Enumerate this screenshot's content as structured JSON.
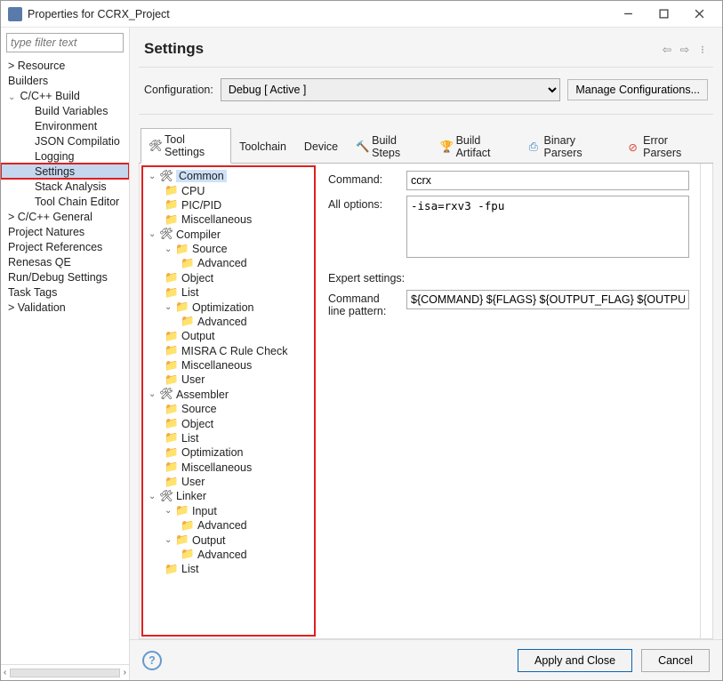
{
  "window": {
    "title": "Properties for CCRX_Project"
  },
  "filter": {
    "placeholder": "type filter text"
  },
  "nav": {
    "resource": ">  Resource",
    "builders": "     Builders",
    "build": "  C/C++ Build",
    "build_vars": "Build Variables",
    "env": "Environment",
    "json": "JSON Compilatio",
    "logging": "Logging",
    "settings": "Settings",
    "stack": "Stack Analysis",
    "tce": "Tool Chain Editor",
    "general": ">  C/C++ General",
    "natures": "     Project Natures",
    "refs": "     Project References",
    "renesas": "     Renesas QE",
    "rundebug": "     Run/Debug Settings",
    "tasktags": "     Task Tags",
    "validation": ">  Validation"
  },
  "header": {
    "title": "Settings"
  },
  "config": {
    "label": "Configuration:",
    "value": "Debug  [ Active ]",
    "manage": "Manage Configurations..."
  },
  "tabs": {
    "toolSettings": "Tool Settings",
    "toolchain": "Toolchain",
    "device": "Device",
    "buildSteps": "Build Steps",
    "buildArtifact": "Build Artifact",
    "binaryParsers": "Binary Parsers",
    "errorParsers": "Error Parsers"
  },
  "tree": {
    "common": "Common",
    "cpu": "CPU",
    "picpid": "PIC/PID",
    "misc": "Miscellaneous",
    "compiler": "Compiler",
    "source": "Source",
    "advanced": "Advanced",
    "object": "Object",
    "list": "List",
    "optimization": "Optimization",
    "output": "Output",
    "misra": "MISRA C Rule Check",
    "user": "User",
    "assembler": "Assembler",
    "linker": "Linker",
    "input": "Input"
  },
  "right": {
    "cmd_label": "Command:",
    "cmd_value": "ccrx",
    "allopt_label": "All options:",
    "allopt_value": "-isa=rxv3 -fpu",
    "expert": "Expert settings:",
    "pattern_label": "Command line pattern:",
    "pattern_value": "${COMMAND} ${FLAGS} ${OUTPUT_FLAG} ${OUTPUT_PREFIX}${O"
  },
  "footer": {
    "apply": "Apply and Close",
    "cancel": "Cancel"
  }
}
